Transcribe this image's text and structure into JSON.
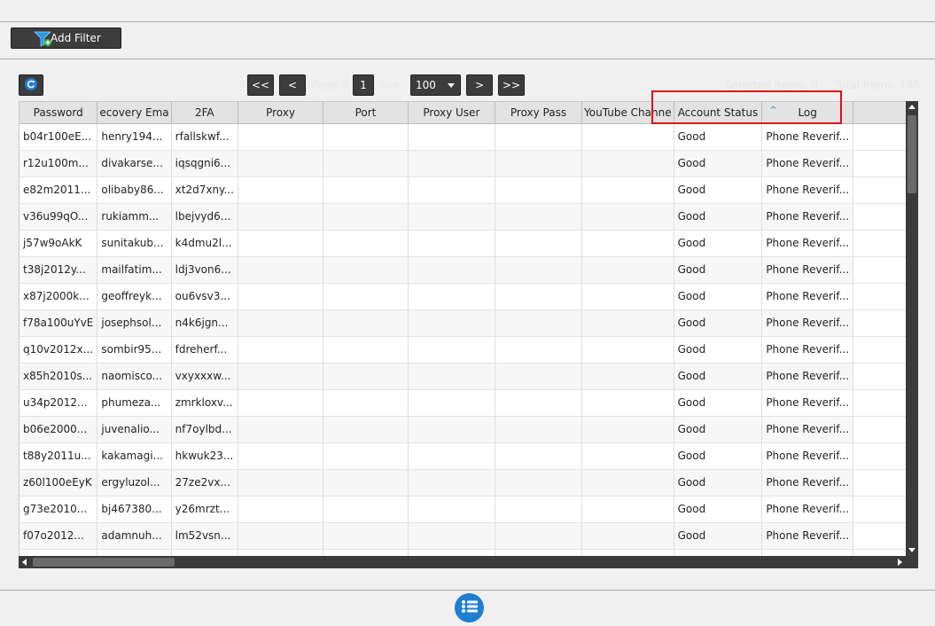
{
  "toolbar": {
    "add_filter_label": "Add Filter"
  },
  "pager": {
    "first_label": "<<",
    "prev_label": "<",
    "next_label": ">",
    "last_label": ">>",
    "page_label": "Page #",
    "page_value": "1",
    "size_label": "size",
    "size_value": "100"
  },
  "info": {
    "selected_text": "Selected Items: 0",
    "total_text": "Total Items: 195"
  },
  "grid": {
    "columns": [
      "Password",
      "ecovery Ema",
      "2FA",
      "Proxy",
      "Port",
      "Proxy User",
      "Proxy Pass",
      "YouTube Channe",
      "Account Status",
      "Log"
    ],
    "sorted_column": "Log",
    "rows": [
      [
        "b04r100eE...",
        "henry194...",
        "rfallskwf...",
        "",
        "",
        "",
        "",
        "",
        "Good",
        "Phone Reverif..."
      ],
      [
        "r12u100m...",
        "divakarse...",
        "iqsqgni6...",
        "",
        "",
        "",
        "",
        "",
        "Good",
        "Phone Reverif..."
      ],
      [
        "e82m2011...",
        "olibaby86...",
        "xt2d7xny...",
        "",
        "",
        "",
        "",
        "",
        "Good",
        "Phone Reverif..."
      ],
      [
        "v36u99qO...",
        "rukiamm...",
        "lbejvyd6...",
        "",
        "",
        "",
        "",
        "",
        "Good",
        "Phone Reverif..."
      ],
      [
        "j57w9oAkK",
        "sunitakub...",
        "k4dmu2l...",
        "",
        "",
        "",
        "",
        "",
        "Good",
        "Phone Reverif..."
      ],
      [
        "t38j2012y...",
        "mailfatim...",
        "ldj3von6...",
        "",
        "",
        "",
        "",
        "",
        "Good",
        "Phone Reverif..."
      ],
      [
        "x87j2000k...",
        "geoffreyk...",
        "ou6vsv3...",
        "",
        "",
        "",
        "",
        "",
        "Good",
        "Phone Reverif..."
      ],
      [
        "f78a100uYvE",
        "josephsol...",
        "n4k6jgn...",
        "",
        "",
        "",
        "",
        "",
        "Good",
        "Phone Reverif..."
      ],
      [
        "q10v2012x...",
        "sombir95...",
        "fdreherf...",
        "",
        "",
        "",
        "",
        "",
        "Good",
        "Phone Reverif..."
      ],
      [
        "x85h2010s...",
        "naomisco...",
        "vxyxxxw...",
        "",
        "",
        "",
        "",
        "",
        "Good",
        "Phone Reverif..."
      ],
      [
        "u34p2012...",
        "phumeza...",
        "zmrkloxv...",
        "",
        "",
        "",
        "",
        "",
        "Good",
        "Phone Reverif..."
      ],
      [
        "b06e2000...",
        "juvenalio...",
        "nf7oylbd...",
        "",
        "",
        "",
        "",
        "",
        "Good",
        "Phone Reverif..."
      ],
      [
        "t88y2011u...",
        "kakamagi...",
        "hkwuk23...",
        "",
        "",
        "",
        "",
        "",
        "Good",
        "Phone Reverif..."
      ],
      [
        "z60l100eEyK",
        "ergyluzol...",
        "27ze2vx...",
        "",
        "",
        "",
        "",
        "",
        "Good",
        "Phone Reverif..."
      ],
      [
        "g73e2010...",
        "bj467380...",
        "y26mrzt...",
        "",
        "",
        "",
        "",
        "",
        "Good",
        "Phone Reverif..."
      ],
      [
        "f07o2012...",
        "adamnuh...",
        "lm52vsn...",
        "",
        "",
        "",
        "",
        "",
        "Good",
        "Phone Reverif..."
      ],
      [
        "",
        "",
        "",
        "",
        "",
        "",
        "",
        "",
        "",
        ""
      ]
    ]
  },
  "icons": {
    "filter": "funnel-plus-icon",
    "refresh": "refresh-icon",
    "menu": "list-menu-icon",
    "sort": "sort-ascending-icon"
  },
  "colors": {
    "toolbar_button": "#3c3c3c",
    "highlight": "#e01010",
    "menu_button": "#1e7fd0",
    "sort_arrow": "#1a8a9a"
  }
}
